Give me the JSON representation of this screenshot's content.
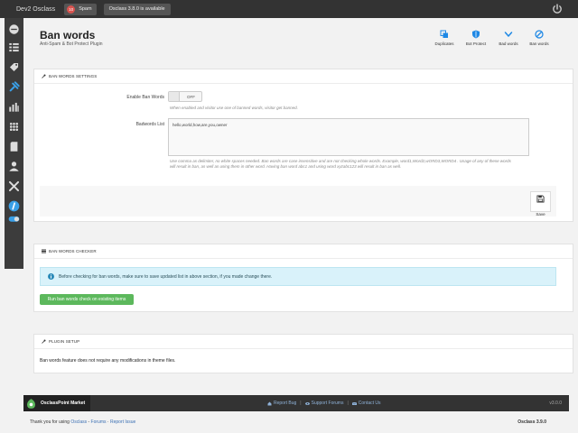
{
  "topbar": {
    "brand": "Dev2 Osclass",
    "spam_count": "10",
    "spam_label": "Spam",
    "update_notice": "Osclass 3.8.0 is available"
  },
  "sidebar": {
    "items": [
      "dashboard-icon",
      "listings-icon",
      "tags-icon",
      "plugins-icon",
      "stats-icon",
      "grid-icon",
      "pages-icon",
      "users-icon",
      "tools-icon",
      "help-icon",
      "toggle-icon"
    ]
  },
  "header": {
    "title": "Ban words",
    "subtitle": "Anti-Spam & Bot Protect Plugin",
    "tools": [
      {
        "label": "Duplicates"
      },
      {
        "label": "Bot Protect"
      },
      {
        "label": "Bad words"
      },
      {
        "label": "Ban words"
      }
    ]
  },
  "settings": {
    "heading": "BAN WORDS SETTINGS",
    "enable_label": "Enable Ban Words",
    "toggle_state": "OFF",
    "enable_help": "When enabled and visitor use one of banned words, visitor get banned.",
    "badwords_label": "Badwords List",
    "badwords_value": "hello,world,how,are,you,owner",
    "badwords_help_1": "Use comma as delimiter, no white spaces needed. Ban words are case insensitive and are not checking whole words. Example, word1,Word2,wORD3,WORD4 . Usage of any of these words",
    "badwords_help_2": "will result in ban, as well as using them in other word. Having ban word abc1 and using word xyzabc123 will result in ban as well.",
    "save_label": "Save"
  },
  "checker": {
    "heading": "BAN WORDS CHECKER",
    "alert_text": "Before checking for ban words, make sure to save updated list in above section, if you made change there.",
    "button_label": "Run ban words check on existing items"
  },
  "setup": {
    "heading": "PLUGIN SETUP",
    "text": "Ban words feature does not require any modifications in theme files."
  },
  "bottombar": {
    "market": "OsclassPoint Market",
    "report_bug": "Report Bug",
    "support_forums": "Support Forums",
    "contact_us": "Contact Us",
    "version": "v3.0.0"
  },
  "credits": {
    "prefix": "Thank you for using",
    "osclass": "Osclass",
    "dash": " - ",
    "forums": "Forums",
    "dot": " · ",
    "report": "Report Issue",
    "version": "Osclass 3.9.0"
  },
  "colors": {
    "topbar": "#333333",
    "green": "#5cb85c",
    "info": "#d9f2fa",
    "accent": "#1e88e5"
  }
}
